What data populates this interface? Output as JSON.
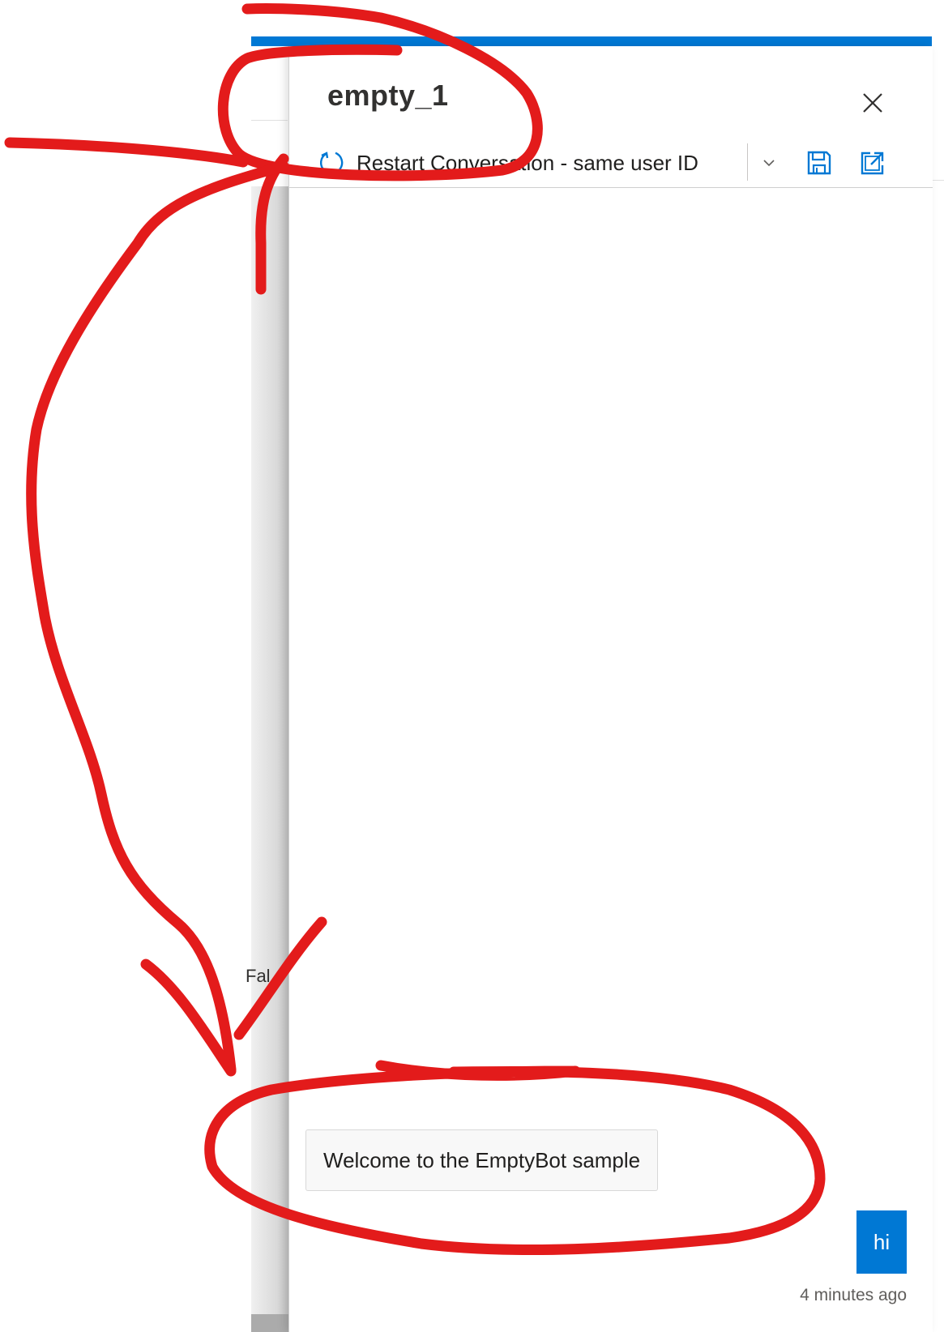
{
  "background": {
    "partial_text": "Fal"
  },
  "panel": {
    "title": "empty_1",
    "close_icon": "close-icon",
    "toolbar": {
      "restart_label": "Restart Conversation - same user ID",
      "restart_icon": "refresh-icon",
      "dropdown_icon": "chevron-down-icon",
      "save_icon": "save-icon",
      "open_icon": "open-in-new-window-icon"
    }
  },
  "chat": {
    "messages": [
      {
        "from": "bot",
        "text": "Welcome to the EmptyBot sample"
      },
      {
        "from": "user",
        "text": "hi"
      }
    ],
    "timestamp": "4 minutes ago"
  },
  "colors": {
    "accent": "#0078d4",
    "annotation": "#e31b1b"
  }
}
